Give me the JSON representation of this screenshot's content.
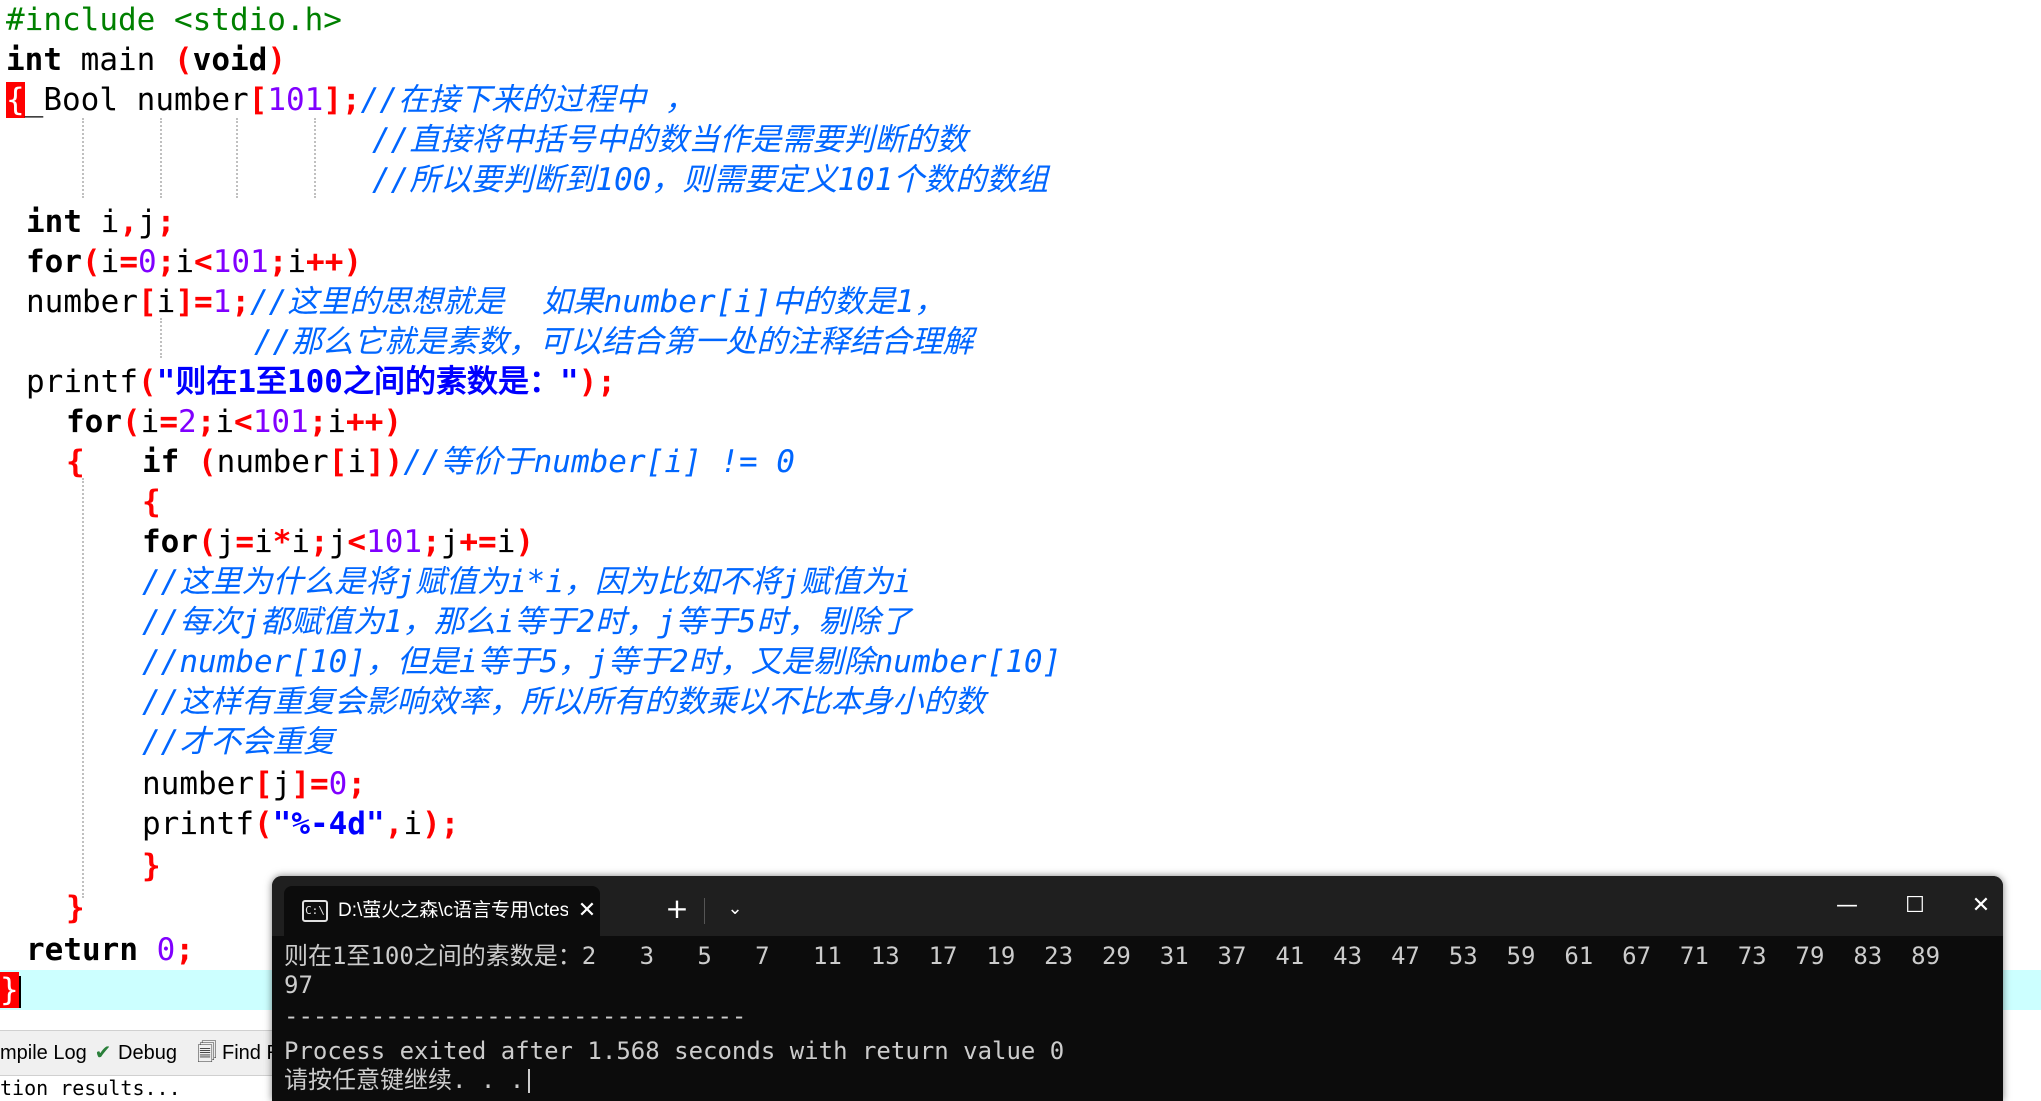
{
  "code": {
    "l1": "#include <stdio.h>",
    "l2_kw": "int",
    "l2_rest": " main ",
    "l2_paren_open": "(",
    "l2_void": "void",
    "l2_paren_close": ")",
    "l3_brace": "{",
    "l3_type": "_Bool",
    "l3_rest": " number",
    "l3_open": "[",
    "l3_num": "101",
    "l3_close": "];",
    "l3_cmt": "//在接下来的过程中 ，",
    "l4_cmt": "//直接将中括号中的数当作是需要判断的数",
    "l5_cmt": "//所以要判断到100，则需要定义101个数的数组",
    "l6_kw": "int",
    "l6_rest": " i",
    "l6_sym1": ",",
    "l6_rest2": "j",
    "l6_sym2": ";",
    "l7_kw": "for",
    "l7_a": "(",
    "l7_b": "i",
    "l7_c": "=",
    "l7_d": "0",
    "l7_e": ";",
    "l7_f": "i",
    "l7_g": "<",
    "l7_h": "101",
    "l7_i": ";",
    "l7_j": "i",
    "l7_k": "++)",
    "l8_a": "number",
    "l8_b": "[",
    "l8_c": "i",
    "l8_d": "]=",
    "l8_e": "1",
    "l8_f": ";",
    "l8_cmt": "//这里的思想就是  如果number[i]中的数是1，",
    "l9_cmt": "//那么它就是素数，可以结合第一处的注释结合理解",
    "l10_a": "printf",
    "l10_b": "(",
    "l10_str": "\"则在1至100之间的素数是：\"",
    "l10_c": ");",
    "l11_kw": "for",
    "l11_a": "(",
    "l11_b": "i",
    "l11_c": "=",
    "l11_d": "2",
    "l11_e": ";",
    "l11_f": "i",
    "l11_g": "<",
    "l11_h": "101",
    "l11_i": ";",
    "l11_j": "i",
    "l11_k": "++)",
    "l12_brace": "{",
    "l12_kw": "if",
    "l12_a": " (",
    "l12_b": "number",
    "l12_c": "[",
    "l12_d": "i",
    "l12_e": "])",
    "l12_cmt": "//等价于number[i] != 0",
    "l13_brace": "{",
    "l14_kw": "for",
    "l14_a": "(",
    "l14_b": "j",
    "l14_c": "=",
    "l14_d": "i",
    "l14_e": "*",
    "l14_f": "i",
    "l14_g": ";",
    "l14_h": "j",
    "l14_i": "<",
    "l14_j": "101",
    "l14_k": ";",
    "l14_l": "j",
    "l14_m": "+=",
    "l14_n": "i",
    "l14_o": ")",
    "l15_cmt": "//这里为什么是将j赋值为i*i，因为比如不将j赋值为i",
    "l16_cmt": "//每次j都赋值为1，那么i等于2时，j等于5时，剔除了",
    "l17_cmt": "//number[10]，但是i等于5，j等于2时，又是剔除number[10]",
    "l18_cmt": "//这样有重复会影响效率，所以所有的数乘以不比本身小的数",
    "l19_cmt": "//才不会重复",
    "l20_a": "number",
    "l20_b": "[",
    "l20_c": "j",
    "l20_d": "]=",
    "l20_e": "0",
    "l20_f": ";",
    "l21_a": "printf",
    "l21_b": "(",
    "l21_str": "\"%-4d\"",
    "l21_c": ",",
    "l21_d": "i",
    "l21_e": ");",
    "l22_brace": "}",
    "l23_brace": "}",
    "l24_kw": "return",
    "l24_sp": " ",
    "l24_num": "0",
    "l24_semi": ";",
    "l25_brace": "}"
  },
  "bottom_pane": {
    "tab_compile_log": "mpile Log",
    "tab_debug": "Debug",
    "tab_find": "Find R",
    "status_text": "tion results..."
  },
  "console": {
    "tab_title": "D:\\萤火之森\\c语言专用\\ctest.e",
    "tab_close": "✕",
    "new_tab": "+",
    "dropdown": "⌄",
    "minimize": "—",
    "maximize": "☐",
    "close": "✕",
    "output_line1": "则在1至100之间的素数是：2   3   5   7   11  13  17  19  23  29  31  37  41  43  47  53  59  61  67  71  73  79  83  89",
    "output_line2": "97",
    "separator": "--------------------------------",
    "process_line": "Process exited after 1.568 seconds with return value 0",
    "prompt_line": "请按任意键继续. . ."
  },
  "colors": {
    "keyword": "#000000",
    "symbol": "#ff0000",
    "number": "#8000ff",
    "string": "#0000ff",
    "comment": "#0066ff",
    "preprocessor": "#008000",
    "current_line": "#ccffff",
    "console_bg": "#0c0c0c",
    "console_text": "#cccccc"
  }
}
